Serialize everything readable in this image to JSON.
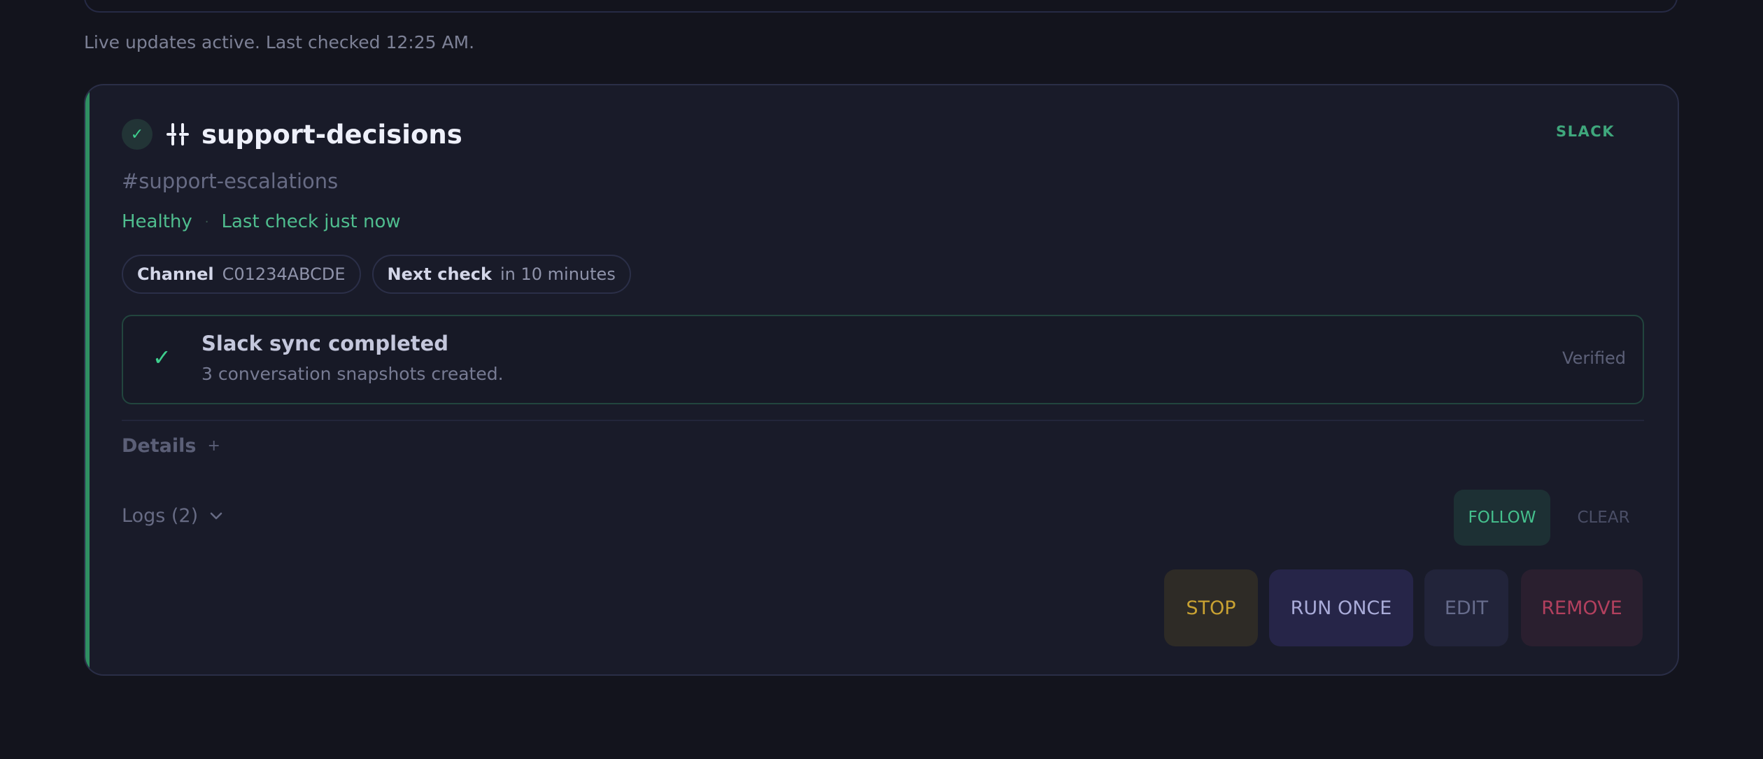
{
  "status_line": "Live updates active. Last checked 12:25 AM.",
  "card": {
    "status_icon": "check-icon",
    "source_icon": "slack-icon",
    "title": "support-decisions",
    "source_tag": "SLACK",
    "channel": "#support-escalations",
    "health": "Healthy",
    "health_separator": "·",
    "last_check": "Last check just now",
    "chips": [
      {
        "key": "Channel",
        "value": "C01234ABCDE"
      },
      {
        "key": "Next check",
        "value": "in 10 minutes"
      }
    ],
    "result": {
      "icon": "check-icon",
      "title": "Slack sync completed",
      "subtitle": "3 conversation snapshots created.",
      "status": "Verified"
    },
    "details": {
      "label": "Details",
      "icon": "plus-icon",
      "glyph": "+"
    },
    "logs": {
      "label": "Logs (2)",
      "icon": "chevron-down-icon"
    },
    "log_actions": {
      "follow": "FOLLOW",
      "clear": "CLEAR"
    },
    "actions": {
      "stop": "STOP",
      "run_once": "RUN ONCE",
      "edit": "EDIT",
      "remove": "REMOVE"
    }
  },
  "colors": {
    "background": "#13141d",
    "card": "#191b29",
    "accent_green": "#3ecf8e",
    "stop": "#c9a232",
    "run": "#a9abd8",
    "remove": "#b2405e"
  }
}
